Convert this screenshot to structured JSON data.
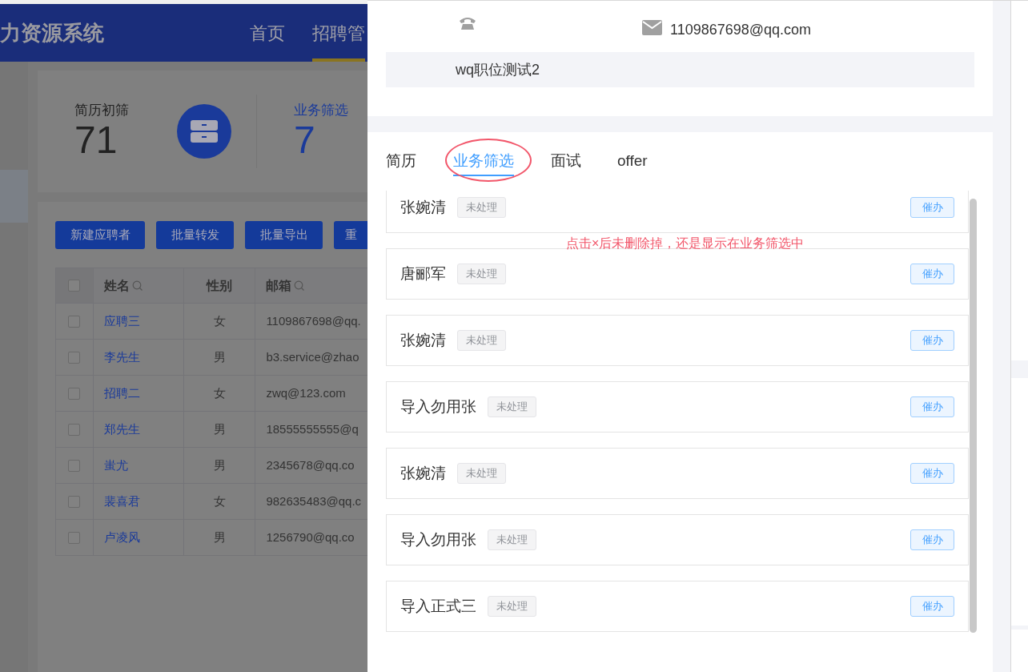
{
  "background_page": {
    "app_title": "力资源系统",
    "nav": [
      {
        "label": "首页",
        "selected": false
      },
      {
        "label": "招聘管",
        "selected": true
      }
    ],
    "stats": [
      {
        "label": "简历初筛",
        "value": "71",
        "selected": false
      },
      {
        "label": "业务筛选",
        "value": "7",
        "selected": true
      }
    ],
    "toolbar_buttons": [
      "新建应聘者",
      "批量转发",
      "批量导出",
      "重"
    ],
    "table": {
      "all_checked": false,
      "columns": [
        {
          "label": "姓名",
          "searchable": true
        },
        {
          "label": "性别",
          "searchable": false
        },
        {
          "label": "邮箱",
          "searchable": true
        }
      ],
      "rows": [
        {
          "checked": false,
          "name": "应聘三",
          "gender": "女",
          "email": "1109867698@qq."
        },
        {
          "checked": false,
          "name": "李先生",
          "gender": "男",
          "email": "b3.service@zhao"
        },
        {
          "checked": false,
          "name": "招聘二",
          "gender": "女",
          "email": "zwq@123.com"
        },
        {
          "checked": false,
          "name": "郑先生",
          "gender": "男",
          "email": "18555555555@q"
        },
        {
          "checked": false,
          "name": "蚩尤",
          "gender": "男",
          "email": "2345678@qq.co"
        },
        {
          "checked": false,
          "name": "裴喜君",
          "gender": "女",
          "email": "982635483@qq.c"
        },
        {
          "checked": false,
          "name": "卢凌风",
          "gender": "男",
          "email": "1256790@qq.co"
        }
      ]
    }
  },
  "drawer": {
    "email": "1109867698@qq.com",
    "position": "wq职位测试2",
    "tabs": [
      {
        "label": "简历",
        "selected": false
      },
      {
        "label": "业务筛选",
        "selected": true
      },
      {
        "label": "面试",
        "selected": false
      },
      {
        "label": "offer",
        "selected": false
      }
    ],
    "candidates": [
      {
        "name": "张婉清",
        "status": "未处理",
        "action": "催办"
      },
      {
        "name": "唐郦军",
        "status": "未处理",
        "action": "催办"
      },
      {
        "name": "张婉清",
        "status": "未处理",
        "action": "催办"
      },
      {
        "name": "导入勿用张",
        "status": "未处理",
        "action": "催办"
      },
      {
        "name": "张婉清",
        "status": "未处理",
        "action": "催办"
      },
      {
        "name": "导入勿用张",
        "status": "未处理",
        "action": "催办"
      },
      {
        "name": "导入正式三",
        "status": "未处理",
        "action": "催办"
      }
    ],
    "annotation": "点击×后未删除掉，还是显示在业务筛选中"
  }
}
